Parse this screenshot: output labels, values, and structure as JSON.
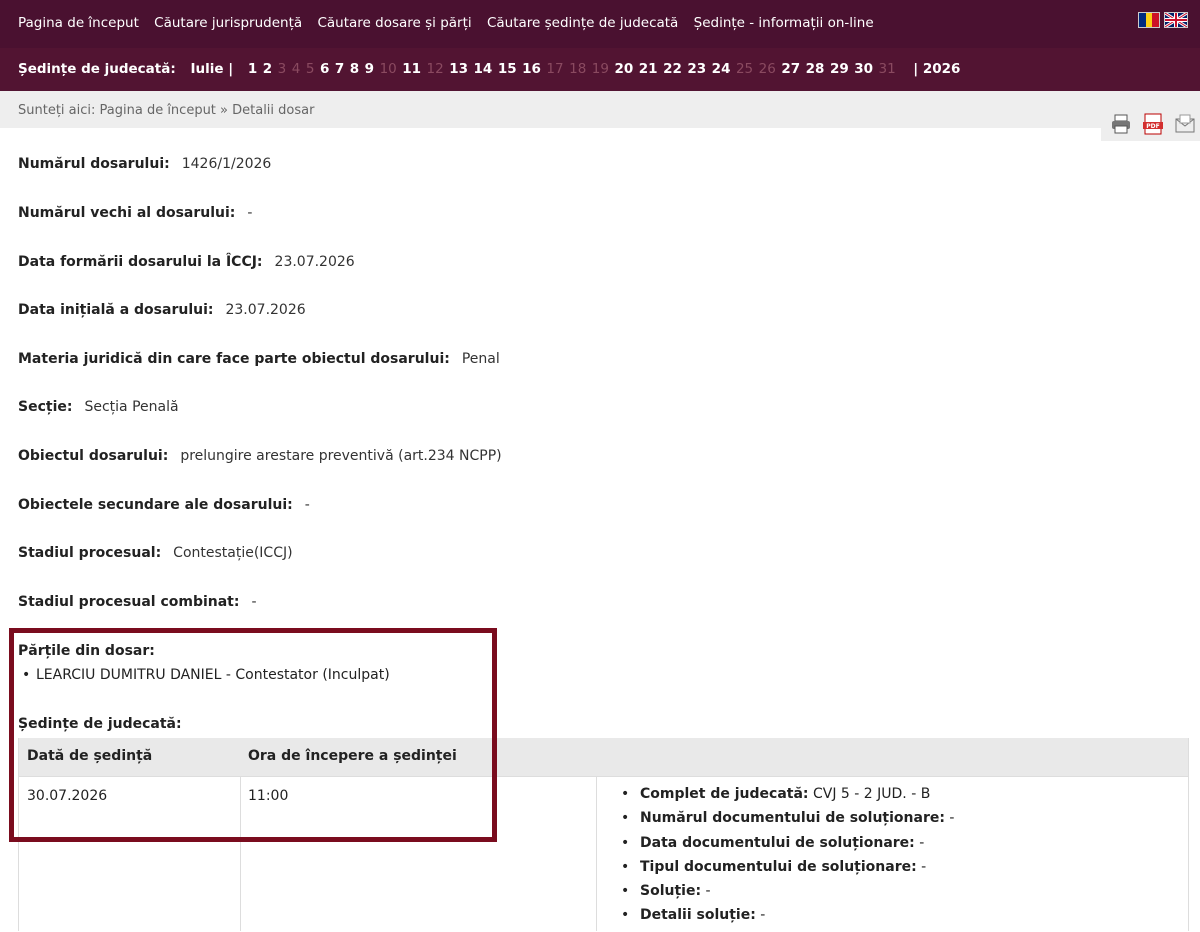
{
  "top_menu": [
    "Pagina de început",
    "Căutare jurisprudență",
    "Căutare dosare și părți",
    "Căutare ședințe de judecată",
    "Ședințe - informații on-line"
  ],
  "day_nav": {
    "label": "Ședințe de judecată:",
    "month": "Iulie |",
    "days": [
      {
        "d": "1",
        "active": true
      },
      {
        "d": "2",
        "active": true
      },
      {
        "d": "3",
        "active": false
      },
      {
        "d": "4",
        "active": false
      },
      {
        "d": "5",
        "active": false
      },
      {
        "d": "6",
        "active": true
      },
      {
        "d": "7",
        "active": true
      },
      {
        "d": "8",
        "active": true
      },
      {
        "d": "9",
        "active": true
      },
      {
        "d": "10",
        "active": false
      },
      {
        "d": "11",
        "active": true
      },
      {
        "d": "12",
        "active": false
      },
      {
        "d": "13",
        "active": true
      },
      {
        "d": "14",
        "active": true
      },
      {
        "d": "15",
        "active": true
      },
      {
        "d": "16",
        "active": true
      },
      {
        "d": "17",
        "active": false
      },
      {
        "d": "18",
        "active": false
      },
      {
        "d": "19",
        "active": false
      },
      {
        "d": "20",
        "active": true
      },
      {
        "d": "21",
        "active": true
      },
      {
        "d": "22",
        "active": true
      },
      {
        "d": "23",
        "active": true
      },
      {
        "d": "24",
        "active": true
      },
      {
        "d": "25",
        "active": false
      },
      {
        "d": "26",
        "active": false
      },
      {
        "d": "27",
        "active": true
      },
      {
        "d": "28",
        "active": true
      },
      {
        "d": "29",
        "active": true
      },
      {
        "d": "30",
        "active": true
      },
      {
        "d": "31",
        "active": false
      }
    ],
    "year": "| 2026"
  },
  "breadcrumb": "Sunteți aici: Pagina de început » Detalii dosar",
  "fields": [
    {
      "k": "Numărul dosarului:",
      "v": "1426/1/2026"
    },
    {
      "k": "Numărul vechi al dosarului:",
      "v": "-"
    },
    {
      "k": "Data formării dosarului la ÎCCJ:",
      "v": "23.07.2026"
    },
    {
      "k": "Data inițială a dosarului:",
      "v": "23.07.2026"
    },
    {
      "k": "Materia juridică din care face parte obiectul dosarului:",
      "v": "Penal"
    },
    {
      "k": "Secție:",
      "v": "Secția Penală"
    },
    {
      "k": "Obiectul dosarului:",
      "v": "prelungire arestare preventivă (art.234 NCPP)"
    },
    {
      "k": "Obiectele secundare ale dosarului:",
      "v": "-"
    },
    {
      "k": "Stadiul procesual:",
      "v": "Contestație(ICCJ)"
    },
    {
      "k": "Stadiul procesual combinat:",
      "v": "-"
    }
  ],
  "parties": {
    "title": "Părțile din dosar:",
    "items": [
      "LEARCIU DUMITRU DANIEL - Contestator (Inculpat)"
    ]
  },
  "hearings": {
    "title": "Ședințe de judecată:",
    "col_date": "Dată de ședință",
    "col_time": "Ora de începere a ședinței",
    "date": "30.07.2026",
    "time": "11:00",
    "details": [
      {
        "k": "Complet de judecată:",
        "v": "CVJ 5 - 2 JUD. - B"
      },
      {
        "k": "Numărul documentului de soluționare:",
        "v": "-"
      },
      {
        "k": "Data documentului de soluționare:",
        "v": "-"
      },
      {
        "k": "Tipul documentului de soluționare:",
        "v": "-"
      },
      {
        "k": "Soluție:",
        "v": "-"
      },
      {
        "k": "Detalii soluție:",
        "v": "-"
      }
    ]
  },
  "colors": {
    "nav_bg": "#4a1130",
    "highlight": "#7a0c1e"
  }
}
